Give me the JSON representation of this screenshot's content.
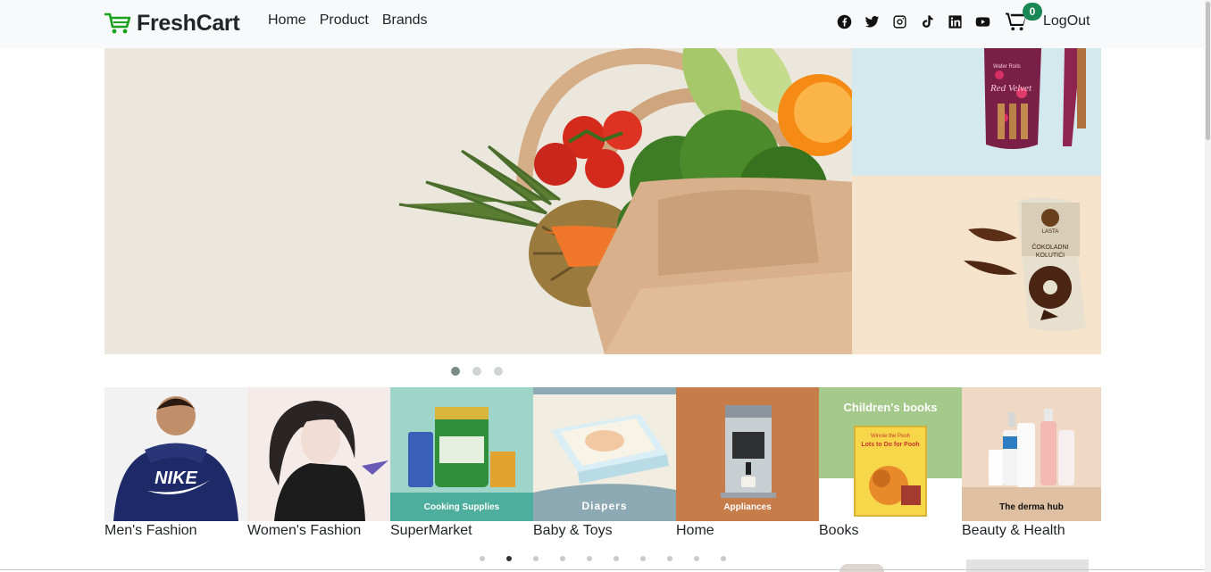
{
  "brand": {
    "name": "FreshCart",
    "accent": "#1aa31a"
  },
  "nav": {
    "links": [
      "Home",
      "Product",
      "Brands"
    ]
  },
  "social_icons": [
    "facebook-icon",
    "twitter-icon",
    "instagram-icon",
    "tiktok-icon",
    "linkedin-icon",
    "youtube-icon"
  ],
  "cart": {
    "count": "0",
    "badge_color": "#198754"
  },
  "auth": {
    "logout_label": "LogOut"
  },
  "hero": {
    "slides": 3,
    "active_slide": 1,
    "side_top_text": {
      "line1": "Red Velvet",
      "line2": "Wafer Rolls"
    },
    "side_bottom_text": {
      "line1": "ČOKOLADNI",
      "line2": "KOLUTIĆI",
      "logo": "LASTA"
    }
  },
  "categories": {
    "items": [
      {
        "label": "Men's Fashion",
        "caption": ""
      },
      {
        "label": "Women's Fashion",
        "caption": ""
      },
      {
        "label": "SuperMarket",
        "caption": "Cooking Supplies"
      },
      {
        "label": "Baby & Toys",
        "caption": "Diapers"
      },
      {
        "label": "Home",
        "caption": "Appliances"
      },
      {
        "label": "Books",
        "caption": "Children's books",
        "book_title": "Lots to Do for Pooh",
        "book_top": "Winnie the Pooh"
      },
      {
        "label": "Beauty & Health",
        "caption": "The derma hub"
      }
    ],
    "pager_dots": 10,
    "active_dot": 2,
    "shirt_text": "NIKE"
  }
}
